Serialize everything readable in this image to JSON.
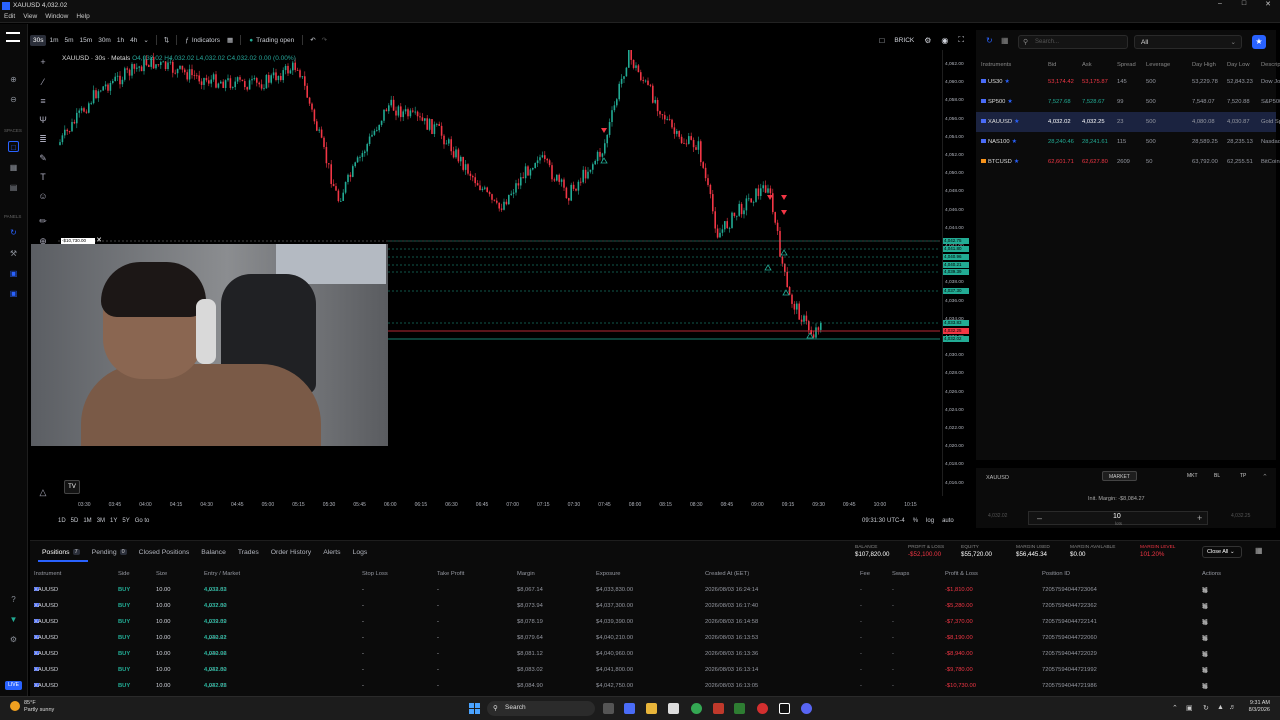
{
  "window": {
    "title": "XAUUSD 4,032.02"
  },
  "menu": [
    "Edit",
    "View",
    "Window",
    "Help"
  ],
  "toolbar": {
    "timeframes": [
      "30s",
      "1m",
      "5m",
      "15m",
      "30m",
      "1h",
      "4h"
    ],
    "indicators": "Indicators",
    "trading_status": "Trading open",
    "brick": "BRICK"
  },
  "leftbar": {
    "spaces_label": "SPACES",
    "panels_label": "PANELS",
    "live": "LIVE"
  },
  "chart": {
    "symbol_line": "XAUUSD · 30s · Metals",
    "ohlc": "O4,032.02 H4,032.02 L4,032.02 C4,032.02 0.00 (0.00%)",
    "price_labels": [
      "4,062.00",
      "4,060.00",
      "4,058.00",
      "4,056.00",
      "4,054.00",
      "4,052.00",
      "4,050.00",
      "4,048.00",
      "4,046.00",
      "4,044.00",
      "4,042.00",
      "4,040.00",
      "4,038.00",
      "4,036.00",
      "4,034.00",
      "4,032.00",
      "4,030.00",
      "4,028.00",
      "4,026.00",
      "4,024.00",
      "4,022.00",
      "4,020.00",
      "4,018.00",
      "4,016.00"
    ],
    "price_tags": [
      {
        "text": "4,042.75",
        "color": "#22ab94"
      },
      {
        "text": "4,041.80",
        "color": "#22ab94"
      },
      {
        "text": "4,040.96",
        "color": "#22ab94"
      },
      {
        "text": "4,040.21",
        "color": "#22ab94"
      },
      {
        "text": "4,039.39",
        "color": "#22ab94"
      },
      {
        "text": "4,037.30",
        "color": "#22ab94"
      },
      {
        "text": "4,033.83",
        "color": "#22ab94"
      },
      {
        "text": "4,032.25",
        "color": "#f23645"
      },
      {
        "text": "4,032.02",
        "color": "#22ab94"
      }
    ],
    "pnl_badge": "-$10,730.00",
    "time_labels": [
      "03:30",
      "03:45",
      "04:00",
      "04:15",
      "04:30",
      "04:45",
      "05:00",
      "05:15",
      "05:30",
      "05:45",
      "06:00",
      "06:15",
      "06:30",
      "06:45",
      "07:00",
      "07:15",
      "07:30",
      "07:45",
      "08:00",
      "08:15",
      "08:30",
      "08:45",
      "09:00",
      "09:15",
      "09:30",
      "09:45",
      "10:00",
      "10:15"
    ],
    "range_buttons": [
      "1D",
      "5D",
      "1M",
      "3M",
      "1Y",
      "5Y",
      "Go to"
    ],
    "clock": "09:31:30 UTC-4",
    "scale_buttons": [
      "%",
      "log",
      "auto"
    ]
  },
  "instruments": {
    "search_placeholder": "Search...",
    "filter": "All",
    "headers": [
      "Instruments",
      "Bid",
      "Ask",
      "Spread",
      "Leverage",
      "Day High",
      "Day Low",
      "Descrip"
    ],
    "rows": [
      {
        "symbol": "US30",
        "bid": "53,174.42",
        "ask": "53,175.87",
        "spread": "145",
        "lev": "500",
        "hi": "53,229.78",
        "lo": "52,843.23",
        "desc": "Dow Jo"
      },
      {
        "symbol": "SP500",
        "bid": "7,527.68",
        "ask": "7,528.67",
        "spread": "99",
        "lev": "500",
        "hi": "7,548.07",
        "lo": "7,520.88",
        "desc": "S&P500"
      },
      {
        "symbol": "XAUUSD",
        "bid": "4,032.02",
        "ask": "4,032.25",
        "spread": "23",
        "lev": "500",
        "hi": "4,080.08",
        "lo": "4,030.87",
        "desc": "Gold Sp"
      },
      {
        "symbol": "NAS100",
        "bid": "28,240.46",
        "ask": "28,241.61",
        "spread": "115",
        "lev": "500",
        "hi": "28,589.25",
        "lo": "28,235.13",
        "desc": "Nasdaq"
      },
      {
        "symbol": "BTCUSD",
        "bid": "62,601.71",
        "ask": "62,627.80",
        "spread": "2609",
        "lev": "50",
        "hi": "63,792.00",
        "lo": "62,255.51",
        "desc": "BitCoin"
      }
    ]
  },
  "order": {
    "symbol": "XAUUSD",
    "type": "MARKET",
    "order_types": [
      "MKT",
      "BL",
      "TP"
    ],
    "margin": "Init. Margin: -$8,084.27",
    "qty": "10",
    "unit": "lots",
    "bid": "4,032.02",
    "ask": "4,032.25"
  },
  "bottom": {
    "tabs": [
      {
        "label": "Positions",
        "count": "7"
      },
      {
        "label": "Pending",
        "count": "0"
      },
      {
        "label": "Closed Positions"
      },
      {
        "label": "Balance"
      },
      {
        "label": "Trades"
      },
      {
        "label": "Order History"
      },
      {
        "label": "Alerts"
      },
      {
        "label": "Logs"
      }
    ],
    "account": [
      {
        "label": "BALANCE",
        "value": "$107,820.00",
        "color": "#ffffff"
      },
      {
        "label": "PROFIT & LOSS",
        "value": "-$52,100.00",
        "color": "#f23645"
      },
      {
        "label": "EQUITY",
        "value": "$55,720.00",
        "color": "#ffffff"
      },
      {
        "label": "MARGIN USED",
        "value": "$56,445.34",
        "color": "#ffffff"
      },
      {
        "label": "MARGIN AVAILABLE",
        "value": "$0.00",
        "color": "#ffffff"
      },
      {
        "label": "MARGIN LEVEL",
        "value": "101.20%",
        "color": "#f23645"
      }
    ],
    "close_all": "Close All",
    "headers": [
      "Instrument",
      "Side",
      "Size",
      "Entry / Market",
      "Stop Loss",
      "Take Profit",
      "Margin",
      "Exposure",
      "Created At (EET)",
      "Fee",
      "Swaps",
      "Profit & Loss",
      "Position ID",
      "Actions"
    ],
    "positions": [
      {
        "ins": "XAUUSD",
        "side": "BUY",
        "size": "10.00",
        "entry": "4,033.83",
        "market": "4,032.02",
        "sl": "-",
        "tp": "-",
        "margin": "$8,067.14",
        "exposure": "$4,033,830.00",
        "created": "2026/08/03 16:24:14",
        "fee": "-",
        "swap": "-",
        "pl": "-$1,810.00",
        "pid": "72057594044723064"
      },
      {
        "ins": "XAUUSD",
        "side": "BUY",
        "size": "10.00",
        "entry": "4,037.30",
        "market": "4,032.02",
        "sl": "-",
        "tp": "-",
        "margin": "$8,073.94",
        "exposure": "$4,037,300.00",
        "created": "2026/08/03 16:17:40",
        "fee": "-",
        "swap": "-",
        "pl": "-$5,280.00",
        "pid": "72057594044722362"
      },
      {
        "ins": "XAUUSD",
        "side": "BUY",
        "size": "10.00",
        "entry": "4,039.39",
        "market": "4,032.02",
        "sl": "-",
        "tp": "-",
        "margin": "$8,078.19",
        "exposure": "$4,039,390.00",
        "created": "2026/08/03 16:14:58",
        "fee": "-",
        "swap": "-",
        "pl": "-$7,370.00",
        "pid": "72057594044722141"
      },
      {
        "ins": "XAUUSD",
        "side": "BUY",
        "size": "10.00",
        "entry": "4,040.21",
        "market": "4,032.02",
        "sl": "-",
        "tp": "-",
        "margin": "$8,079.64",
        "exposure": "$4,040,210.00",
        "created": "2026/08/03 16:13:53",
        "fee": "-",
        "swap": "-",
        "pl": "-$8,190.00",
        "pid": "72057594044722060"
      },
      {
        "ins": "XAUUSD",
        "side": "BUY",
        "size": "10.00",
        "entry": "4,040.96",
        "market": "4,032.02",
        "sl": "-",
        "tp": "-",
        "margin": "$8,081.12",
        "exposure": "$4,040,960.00",
        "created": "2026/08/03 16:13:36",
        "fee": "-",
        "swap": "-",
        "pl": "-$8,940.00",
        "pid": "72057594044722029"
      },
      {
        "ins": "XAUUSD",
        "side": "BUY",
        "size": "10.00",
        "entry": "4,041.80",
        "market": "4,032.02",
        "sl": "-",
        "tp": "-",
        "margin": "$8,083.02",
        "exposure": "$4,041,800.00",
        "created": "2026/08/03 16:13:14",
        "fee": "-",
        "swap": "-",
        "pl": "-$9,780.00",
        "pid": "72057594044721992"
      },
      {
        "ins": "XAUUSD",
        "side": "BUY",
        "size": "10.00",
        "entry": "4,042.75",
        "market": "4,032.02",
        "sl": "-",
        "tp": "-",
        "margin": "$8,084.90",
        "exposure": "$4,042,750.00",
        "created": "2026/08/03 16:13:05",
        "fee": "-",
        "swap": "-",
        "pl": "-$10,730.00",
        "pid": "72057594044721986"
      }
    ]
  },
  "taskbar": {
    "temp": "85°F",
    "weather": "Partly sunny",
    "search": "Search",
    "time": "9:31 AM",
    "date": "8/3/2026"
  }
}
